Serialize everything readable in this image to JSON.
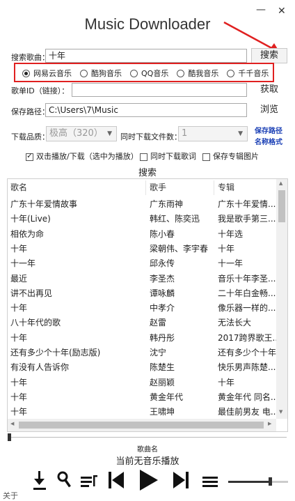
{
  "window": {
    "title": "Music Downloader",
    "minimize_glyph": "—",
    "close_glyph": "✕"
  },
  "search": {
    "label": "搜索歌曲：",
    "value": "十年",
    "button": "搜索"
  },
  "sources": [
    {
      "label": "网易云音乐",
      "selected": true
    },
    {
      "label": "酷狗音乐",
      "selected": false
    },
    {
      "label": "QQ音乐",
      "selected": false
    },
    {
      "label": "酷我音乐",
      "selected": false
    },
    {
      "label": "千千音乐",
      "selected": false
    }
  ],
  "song_id": {
    "label": "歌单ID（链接）：",
    "value": "",
    "button": "获取"
  },
  "save_path": {
    "label": "保存路径：",
    "value": "C:\\Users\\7\\Music",
    "button": "浏览"
  },
  "quality": {
    "label": "下载品质：",
    "value": "极高（320）"
  },
  "concurrent": {
    "label": "同时下载文件数：",
    "value": "1"
  },
  "links": {
    "save_path": "保存路径",
    "name_format": "名称格式"
  },
  "options": [
    {
      "label": "双击播放/下载（选中为播放）",
      "checked": true
    },
    {
      "label": "同时下载歌词",
      "checked": false
    },
    {
      "label": "保存专辑图片",
      "checked": false
    }
  ],
  "results_title": "搜索",
  "table": {
    "columns": [
      "歌名",
      "歌手",
      "专辑"
    ],
    "rows": [
      [
        "广东十年爱情故事",
        "广东雨神",
        "广东十年爱情..."
      ],
      [
        "十年(Live)",
        "韩红、陈奕迅",
        "我是歌手第三..."
      ],
      [
        "相依为命",
        "陈小春",
        "十年选"
      ],
      [
        "十年",
        "梁朝伟、李宇春",
        "十年"
      ],
      [
        "十一年",
        "邱永传",
        "十一年"
      ],
      [
        "最近",
        "李圣杰",
        "音乐十年李圣..."
      ],
      [
        "讲不出再见",
        "谭咏麟",
        "二十年白金畅..."
      ],
      [
        "十年",
        "中孝介",
        "像乐器一样的..."
      ],
      [
        "八十年代的歌",
        "赵雷",
        "无法长大"
      ],
      [
        "十年",
        "韩丹彤",
        "2017跨界歌王..."
      ],
      [
        "还有多少个十年(励志版)",
        "沈宁",
        "还有多少个十年"
      ],
      [
        "有没有人告诉你",
        "陈楚生",
        "快乐男声陈楚..."
      ],
      [
        "十年",
        "赵丽颖",
        "十年"
      ],
      [
        "十年",
        "黄金年代",
        "黄金年代 同名..."
      ],
      [
        "十年",
        "王啸坤",
        "最佳前男友 电..."
      ]
    ]
  },
  "player": {
    "song_name": "歌曲名",
    "status": "当前无音乐播放",
    "volume": 0.7
  },
  "footer": {
    "about": "关于"
  },
  "icons": [
    "download-icon",
    "search-icon",
    "playlist-icon",
    "previous-icon",
    "play-icon",
    "next-icon",
    "menu-icon"
  ]
}
